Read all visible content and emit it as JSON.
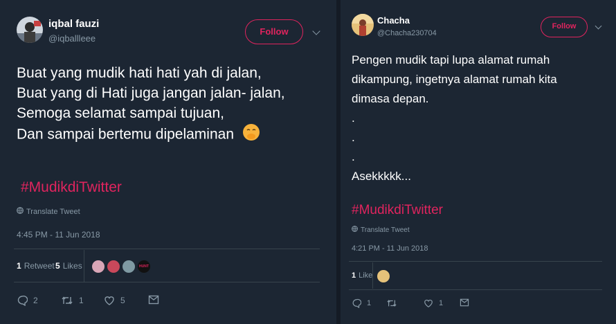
{
  "tweets": [
    {
      "name": "iqbal fauzi",
      "handle": "@iqballleee",
      "follow_label": "Follow",
      "lines": [
        "Buat yang mudik hati hati yah di jalan,",
        "Buat yang di Hati juga jangan jalan- jalan,",
        "Semoga selamat sampai tujuan,",
        "Dan sampai bertemu dipelaminan"
      ],
      "hashtag": "#MudikdiTwitter",
      "translate": "Translate Tweet",
      "timestamp": "4:45 PM - 11 Jun 2018",
      "retweets_count": "1",
      "retweets_label": "Retweet",
      "likes_count": "5",
      "likes_label": "Likes",
      "liker_badge": "HUNT",
      "actions": {
        "replies": "2",
        "retweets": "1",
        "likes": "5"
      }
    },
    {
      "name": "Chacha",
      "handle": "@Chacha230704",
      "follow_label": "Follow",
      "lines": [
        "Pengen mudik tapi lupa alamat rumah",
        "dikampung, ingetnya alamat rumah kita",
        "dimasa depan.",
        ".",
        ".",
        ".",
        "Asekkkkk..."
      ],
      "hashtag": "#MudikdiTwitter",
      "translate": "Translate Tweet",
      "timestamp": "4:21 PM - 11 Jun 2018",
      "likes_count": "1",
      "likes_label": "Like",
      "actions": {
        "replies": "1",
        "retweets": "",
        "likes": "1"
      }
    }
  ],
  "colors": {
    "background": "#1c2633",
    "accent": "#e0245e",
    "muted": "#8899a6",
    "divider": "#38444d"
  },
  "icons": [
    "globe-icon",
    "reply-icon",
    "retweet-icon",
    "like-icon",
    "message-icon",
    "chevron-down-icon",
    "face-emoji-icon"
  ]
}
